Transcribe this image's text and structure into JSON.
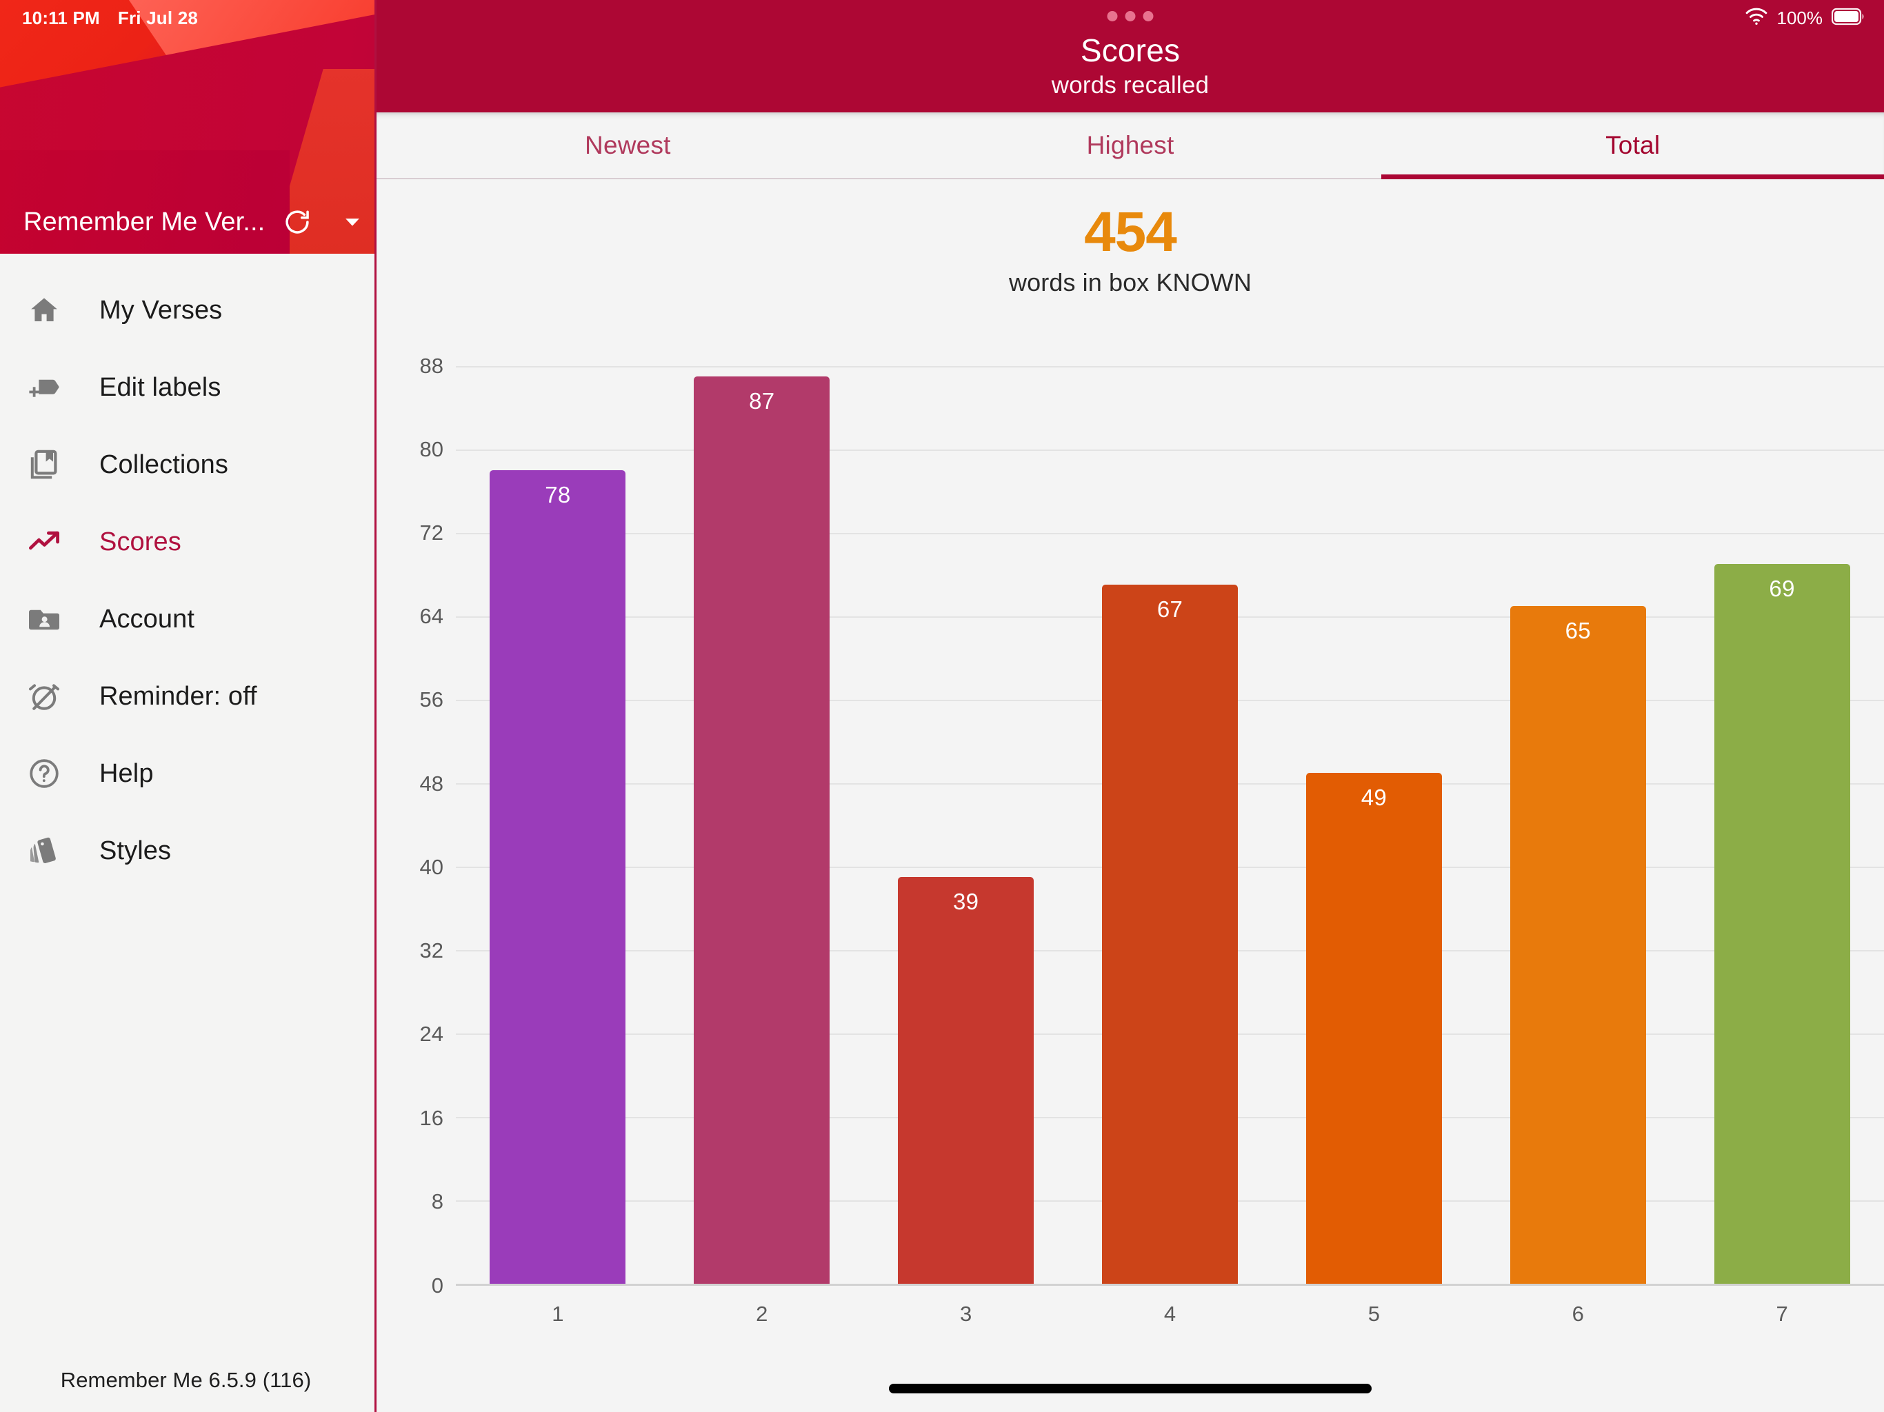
{
  "status_bar": {
    "time": "10:11 PM",
    "date": "Fri Jul 28",
    "wifi_icon": "wifi-icon",
    "battery_percent": "100%",
    "battery_icon": "battery-full-icon"
  },
  "sidebar": {
    "title": "Remember Me Ver...",
    "refresh_icon": "refresh-icon",
    "dropdown_icon": "chevron-down-icon",
    "items": [
      {
        "label": "My Verses",
        "icon": "home-icon",
        "active": false
      },
      {
        "label": "Edit labels",
        "icon": "label-add-icon",
        "active": false
      },
      {
        "label": "Collections",
        "icon": "book-bookmark-icon",
        "active": false
      },
      {
        "label": "Scores",
        "icon": "trending-up-icon",
        "active": true
      },
      {
        "label": "Account",
        "icon": "folder-user-icon",
        "active": false
      },
      {
        "label": "Reminder: off",
        "icon": "alarm-off-icon",
        "active": false
      },
      {
        "label": "Help",
        "icon": "help-circle-icon",
        "active": false
      },
      {
        "label": "Styles",
        "icon": "style-swatch-icon",
        "active": false
      }
    ],
    "version": "Remember Me 6.5.9 (116)"
  },
  "app_bar": {
    "title": "Scores",
    "subtitle": "words recalled",
    "overflow_icon": "more-horizontal-icon",
    "background_color": "#ad0734"
  },
  "tabs": [
    {
      "label": "Newest",
      "active": false
    },
    {
      "label": "Highest",
      "active": false
    },
    {
      "label": "Total",
      "active": true
    }
  ],
  "summary": {
    "value": "454",
    "label": "words in box KNOWN",
    "value_color": "#e8890c"
  },
  "chart_data": {
    "type": "bar",
    "title": "",
    "xlabel": "",
    "ylabel": "",
    "categories": [
      "1",
      "2",
      "3",
      "4",
      "5",
      "6",
      "7"
    ],
    "values": [
      78,
      87,
      39,
      67,
      49,
      65,
      69
    ],
    "bar_colors": [
      "#9a3cba",
      "#b23a6a",
      "#c6382e",
      "#cc4418",
      "#e25c03",
      "#e87a0c",
      "#8cad47"
    ],
    "data_labels": [
      "78",
      "87",
      "39",
      "67",
      "49",
      "65",
      "69"
    ],
    "yticks": [
      0,
      8,
      16,
      24,
      32,
      40,
      48,
      56,
      64,
      72,
      80,
      88
    ],
    "ytick_labels": [
      "0",
      "8",
      "16",
      "24",
      "32",
      "40",
      "48",
      "56",
      "64",
      "72",
      "80",
      "88"
    ],
    "ylim": [
      0,
      92
    ],
    "grid": true,
    "legend": false
  }
}
